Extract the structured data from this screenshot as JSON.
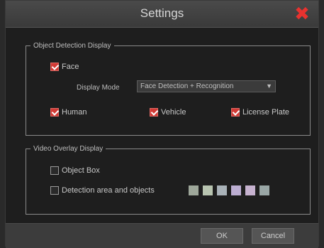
{
  "dialog": {
    "title": "Settings"
  },
  "object_detection": {
    "legend": "Object Detection Display",
    "face": {
      "label": "Face",
      "checked": true
    },
    "display_mode": {
      "label": "Display Mode",
      "value": "Face Detection + Recognition"
    },
    "human": {
      "label": "Human",
      "checked": true
    },
    "vehicle": {
      "label": "Vehicle",
      "checked": true
    },
    "license_plate": {
      "label": "License Plate",
      "checked": true
    }
  },
  "video_overlay": {
    "legend": "Video Overlay Display",
    "object_box": {
      "label": "Object Box",
      "checked": false
    },
    "detection_area": {
      "label": "Detection area and objects",
      "checked": false
    },
    "swatch_colors": [
      "#9ea79a",
      "#b8c4b0",
      "#a9b2b8",
      "#bcaed2",
      "#c6b2cf",
      "#9aa7a6"
    ]
  },
  "footer": {
    "ok": "OK",
    "cancel": "Cancel"
  },
  "colors": {
    "checked": "#d23a35",
    "close": "#e8322f"
  }
}
